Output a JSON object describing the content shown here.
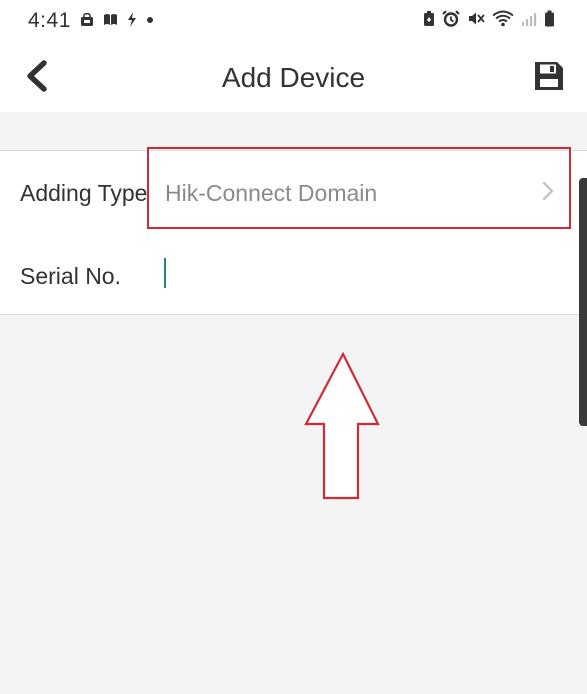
{
  "status_bar": {
    "time": "4:41",
    "left_icons": [
      "bag-icon",
      "book-icon",
      "flash-icon",
      "dot-icon"
    ],
    "right_icons": [
      "battery-saver-icon",
      "alarm-icon",
      "mute-icon",
      "wifi-icon",
      "signal-icon",
      "battery-icon"
    ]
  },
  "header": {
    "title": "Add Device",
    "back_icon": "chevron-left-icon",
    "save_icon": "save-icon"
  },
  "form": {
    "adding_type": {
      "label": "Adding Type",
      "value": "Hik-Connect Domain"
    },
    "serial_no": {
      "label": "Serial No.",
      "value": "",
      "placeholder": ""
    }
  },
  "colors": {
    "highlight": "#d12a35",
    "caret": "#1a8a79",
    "background": "#f4f4f4"
  }
}
